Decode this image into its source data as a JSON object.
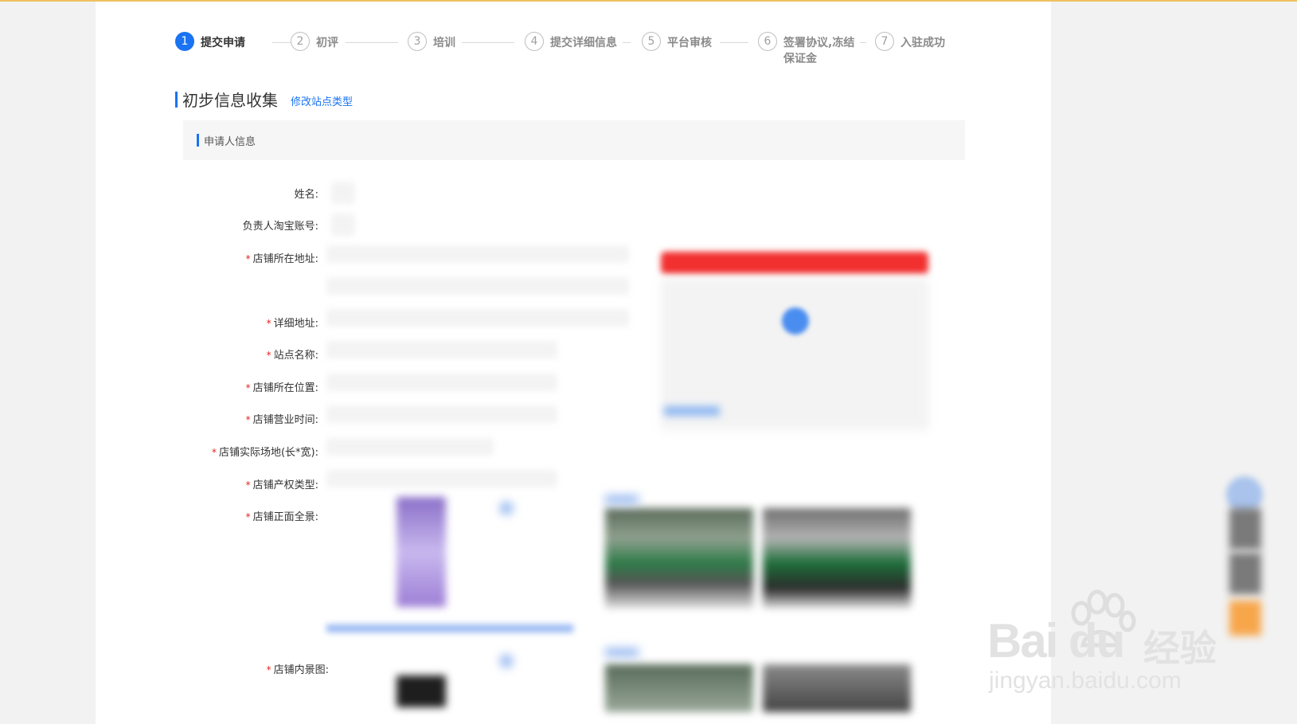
{
  "steps": [
    {
      "num": "1",
      "label": "提交申请",
      "label2": ""
    },
    {
      "num": "2",
      "label": "初评",
      "label2": ""
    },
    {
      "num": "3",
      "label": "培训",
      "label2": ""
    },
    {
      "num": "4",
      "label": "提交详细信息",
      "label2": ""
    },
    {
      "num": "5",
      "label": "平台审核",
      "label2": ""
    },
    {
      "num": "6",
      "label": "签署协议,冻结",
      "label2": "保证金"
    },
    {
      "num": "7",
      "label": "入驻成功",
      "label2": ""
    }
  ],
  "section": {
    "title": "初步信息收集",
    "modify_link": "修改站点类型"
  },
  "subheader": {
    "title": "申请人信息"
  },
  "form": {
    "name_label": "姓名:",
    "taobao_label": "负责人淘宝账号:",
    "address_label": "店铺所在地址:",
    "detail_address_label": "详细地址:",
    "site_name_label": "站点名称:",
    "location_label": "店铺所在位置:",
    "hours_label": "店铺营业时间:",
    "area_label": "店铺实际场地(长*宽):",
    "property_label": "店铺产权类型:",
    "front_label": "店铺正面全景:",
    "inside_label": "店铺内景图:",
    "required_mark": "*"
  },
  "watermark": {
    "logo": "Bai du",
    "brand": "经验",
    "url": "jingyan.baidu.com"
  },
  "colors": {
    "accent": "#1a73f2",
    "required": "#e2231a",
    "banner": "#f23030",
    "orange": "#f7a64a"
  }
}
